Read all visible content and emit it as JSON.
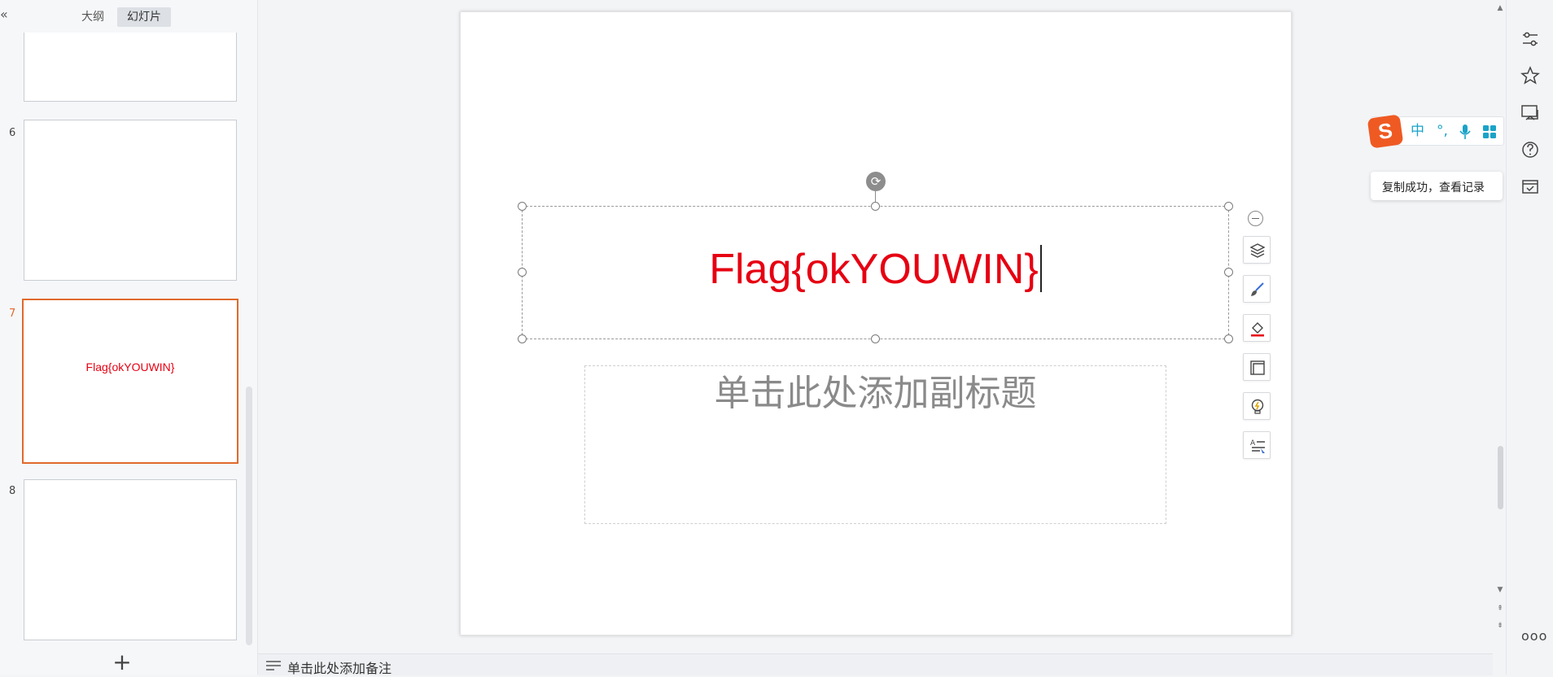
{
  "left_panel": {
    "tabs": [
      {
        "label": "大纲"
      },
      {
        "label": "幻灯片"
      }
    ],
    "slides": [
      {
        "number": "",
        "text": ""
      },
      {
        "number": "6",
        "text": ""
      },
      {
        "number": "7",
        "text": "Flag{okYOUWIN}",
        "selected": true
      },
      {
        "number": "8",
        "text": ""
      }
    ],
    "add_slide_symbol": "+"
  },
  "canvas": {
    "title": "Flag{okYOUWIN}",
    "subtitle_placeholder": "单击此处添加副标题",
    "title_color": "#e60012"
  },
  "float_toolbar": {
    "tools": [
      "layers-icon",
      "brush-icon",
      "fill-icon",
      "frame-icon",
      "bulb-icon",
      "text-effect-icon"
    ]
  },
  "notes": {
    "placeholder": "单击此处添加备注"
  },
  "ime": {
    "mode": "中",
    "punct": "°,"
  },
  "toast": {
    "message": "复制成功，查看记录"
  },
  "right_sidebar": {
    "icons": [
      "sliders-icon",
      "star-icon",
      "slideshow-icon",
      "help-icon",
      "archive-icon"
    ],
    "more": "ooo"
  },
  "colors": {
    "accent_selected": "#e06a2c",
    "ime_brand": "#ef5a23"
  }
}
